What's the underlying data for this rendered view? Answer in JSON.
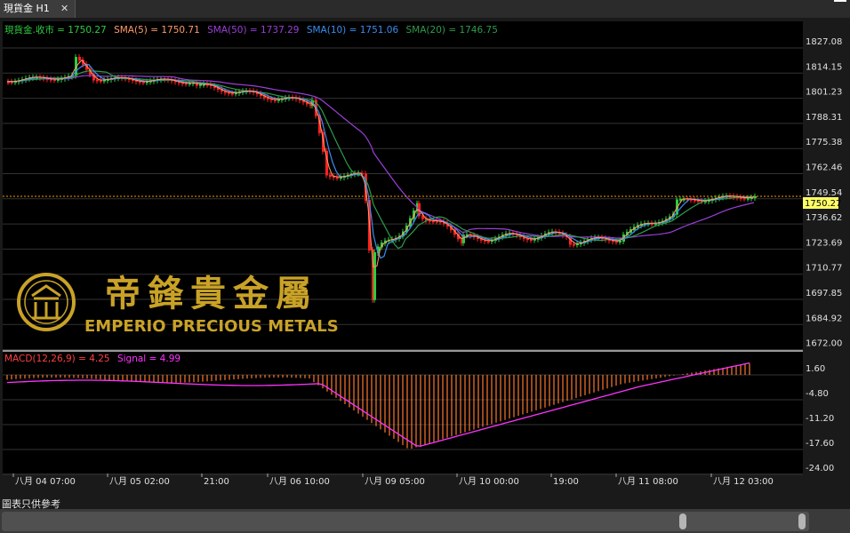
{
  "tab": {
    "title": "現貨金 H1",
    "close": "✕"
  },
  "legend": {
    "price": "現貨金.收市 = 1750.27",
    "sma5": "SMA(5) = 1750.71",
    "sma50": "SMA(50) = 1737.29",
    "sma10": "SMA(10) = 1751.06",
    "sma20": "SMA(20) = 1746.75"
  },
  "macd_legend": {
    "macd": "MACD(12,26,9) = 4.25",
    "signal": "Signal = 4.99"
  },
  "price_axis": [
    "1827.08",
    "1814.15",
    "1801.23",
    "1788.31",
    "1775.38",
    "1762.46",
    "1749.54",
    "1736.62",
    "1723.69",
    "1710.77",
    "1697.85",
    "1684.92",
    "1672.00"
  ],
  "macd_axis": [
    "1.60",
    "-4.80",
    "-11.20",
    "-17.60",
    "-24.00"
  ],
  "current_price": "1750.27",
  "time_axis": [
    "八月 04 07:00",
    "八月 05 02:00",
    "21:00",
    "八月 06 10:00",
    "八月 09 05:00",
    "八月 10 00:00",
    "19:00",
    "八月 11 08:00",
    "八月 12 03:00"
  ],
  "watermark": {
    "company_cn": "帝鋒貴金屬",
    "company_en": "EMPERIO PRECIOUS METALS"
  },
  "disclaimer": "圖表只供參考",
  "colors": {
    "background": "#000000",
    "up": "#2ecc40",
    "down": "#ff2020",
    "sma5": "#ff9a6a",
    "sma10": "#3a8df0",
    "sma20": "#2e9b4a",
    "sma50": "#9b3fd8",
    "macd": "#ff33ff",
    "hist": "#ff7a2e",
    "price_line": "#ff9900",
    "gold": "#c9a227"
  },
  "chart_data": {
    "type": "candlestick",
    "price_range": [
      1672.0,
      1827.08
    ],
    "macd_range": [
      -24.0,
      1.6
    ],
    "close": [
      1750.27
    ],
    "indicators": {
      "sma5": 1750.71,
      "sma10": 1751.06,
      "sma20": 1746.75,
      "sma50": 1737.29,
      "macd": 4.25,
      "signal": 4.99
    }
  }
}
